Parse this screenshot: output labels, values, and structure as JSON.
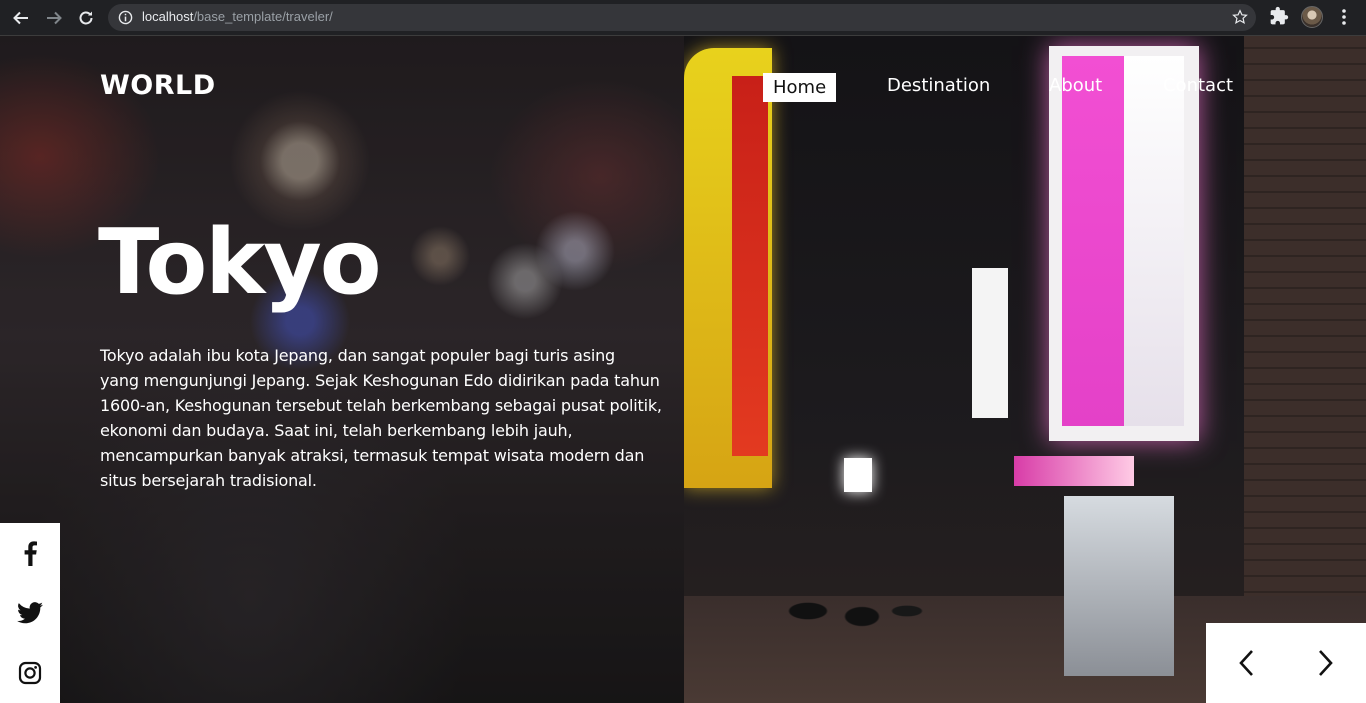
{
  "browser": {
    "url_host": "localhost",
    "url_path": "/base_template/traveler/"
  },
  "header": {
    "logo": "WORLD",
    "nav": [
      {
        "label": "Home",
        "active": true
      },
      {
        "label": "Destination",
        "active": false
      },
      {
        "label": "About",
        "active": false
      },
      {
        "label": "Contact",
        "active": false
      }
    ]
  },
  "hero": {
    "title": "Tokyo",
    "description_lines": [
      "Tokyo adalah ibu kota Jepang, dan sangat populer bagi turis asing",
      "yang mengunjungi Jepang. Sejak Keshogunan Edo didirikan pada tahun",
      "1600-an, Keshogunan tersebut telah berkembang sebagai pusat politik,",
      "ekonomi dan budaya. Saat ini, telah berkembang lebih jauh,",
      "mencampurkan banyak atraksi, termasuk tempat wisata modern dan",
      "situs bersejarah tradisional."
    ]
  },
  "social": [
    "facebook-icon",
    "twitter-icon",
    "instagram-icon"
  ],
  "slider": [
    "chevron-left-icon",
    "chevron-right-icon"
  ],
  "colors": {
    "chrome_bg": "#202124",
    "omnibox_bg": "#35363a",
    "text": "#ffffff",
    "active_nav_bg": "#ffffff"
  }
}
